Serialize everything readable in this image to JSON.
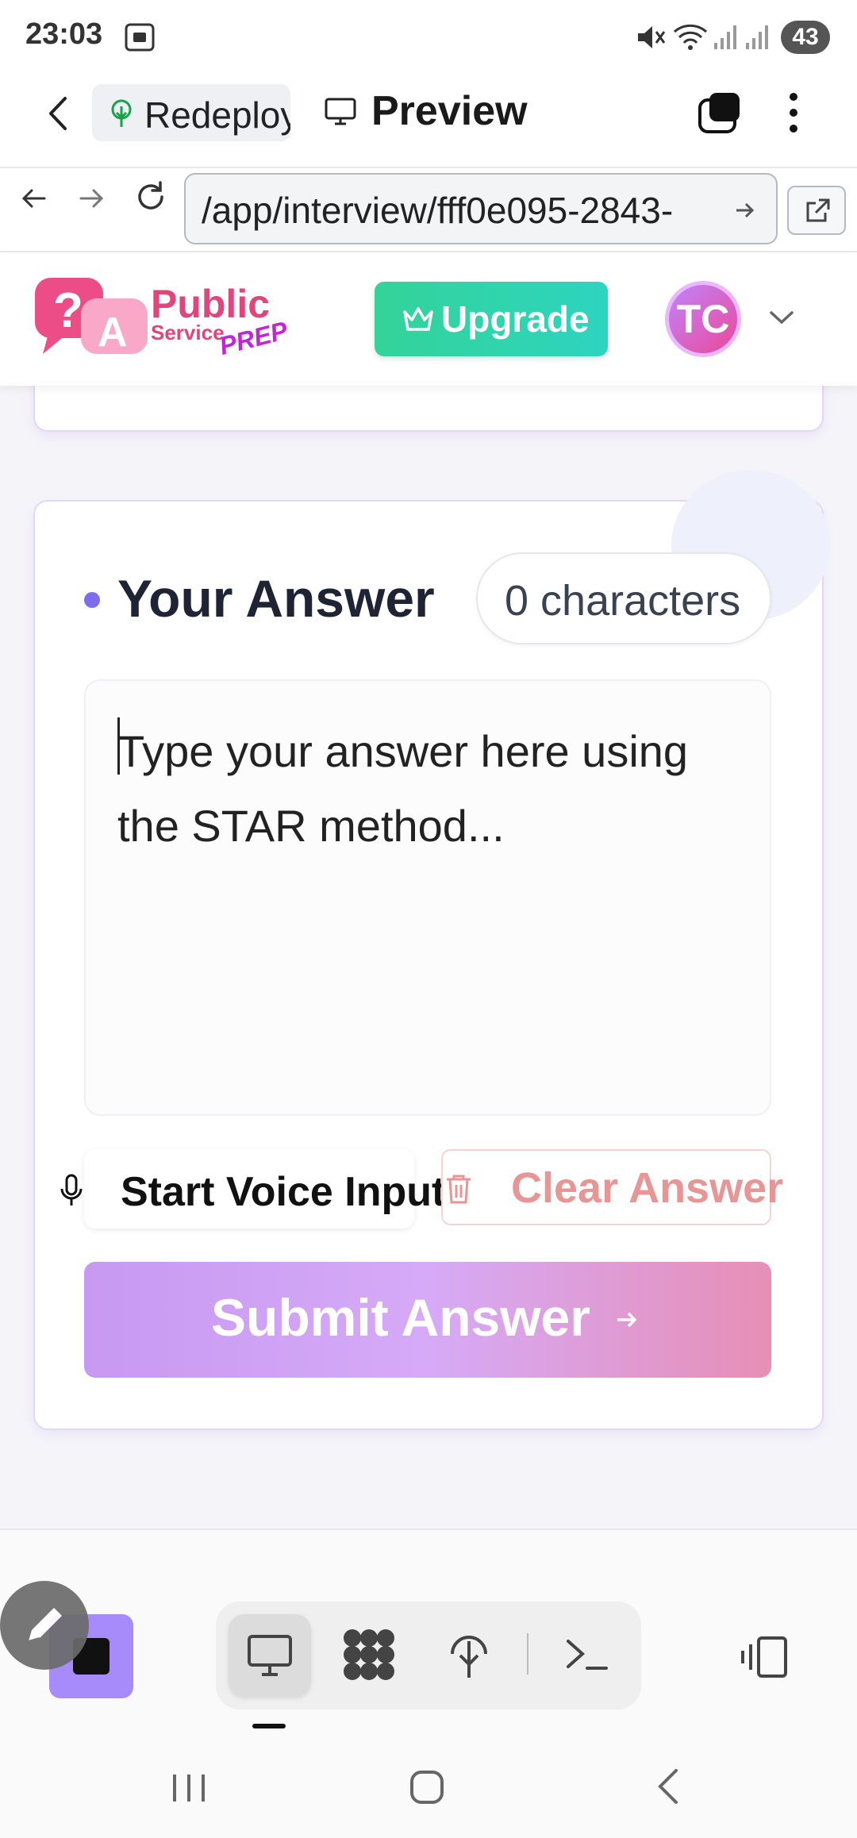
{
  "status_bar": {
    "time": "23:03",
    "battery": "43"
  },
  "browser": {
    "tab_redeploy": "Redeploy",
    "tab_preview": "Preview",
    "url": "/app/interview/fff0e095-2843-"
  },
  "header": {
    "logo": {
      "line1": "Public",
      "line2": "Service",
      "line3": "PREP"
    },
    "upgrade_label": "Upgrade",
    "avatar_initials": "TC"
  },
  "answer": {
    "title": "Your Answer",
    "char_count": "0 characters",
    "placeholder": "Type your answer here using the STAR method...",
    "value": "",
    "voice_label": "Start Voice Input",
    "clear_label": "Clear Answer",
    "submit_label": "Submit Answer"
  },
  "colors": {
    "upgrade": "#34d399",
    "submit_start": "#c799f2",
    "submit_end": "#e78fb6",
    "clear_text": "#e79595",
    "accent_dot": "#7c6cf0"
  },
  "icons": [
    "screenshot-icon",
    "mute-icon",
    "wifi-icon",
    "signal-icon",
    "back-icon",
    "tree-icon",
    "monitor-icon",
    "tabs-icon",
    "more-icon",
    "refresh-icon",
    "forward-icon",
    "external-link-icon",
    "crown-icon",
    "chevron-down-icon",
    "mic-icon",
    "trash-icon",
    "arrow-right-icon",
    "pencil-icon",
    "stop-icon",
    "grid-icon",
    "terminal-icon",
    "device-switch-icon",
    "home-icon",
    "recent-apps-icon"
  ]
}
